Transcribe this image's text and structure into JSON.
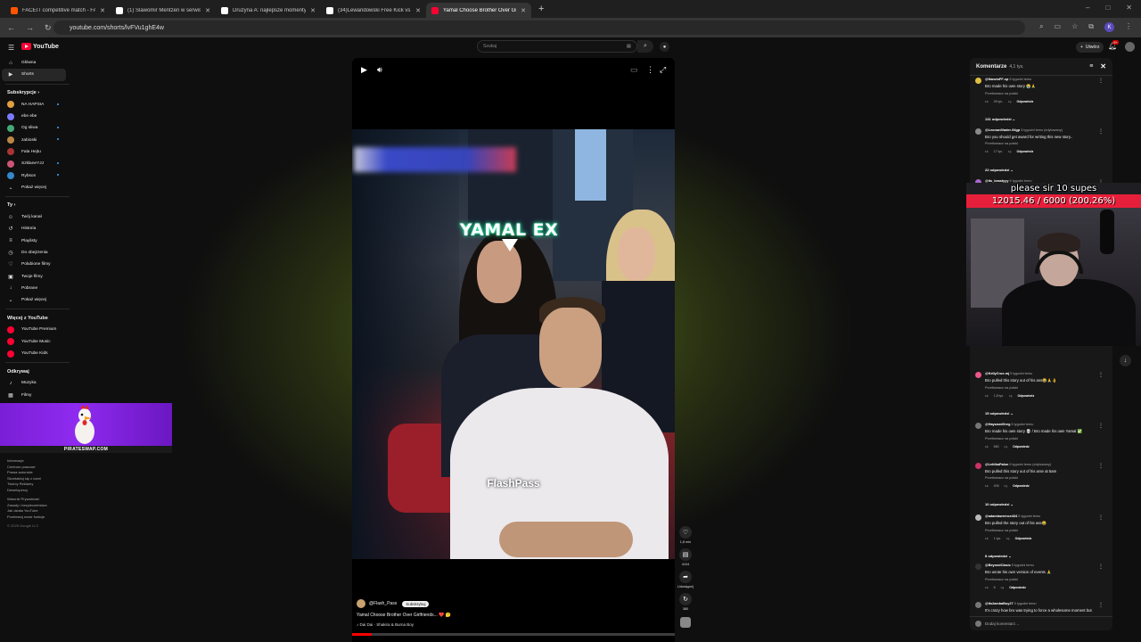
{
  "browser": {
    "tabs": [
      {
        "title": "FACEIT competitive match - FA",
        "color": "#ff5500",
        "active": false
      },
      {
        "title": "(1) Slawomir Mentzen w serwis",
        "color": "#ffffff",
        "active": false
      },
      {
        "title": "Drużyna A: najlepsze momenty",
        "color": "#ffffff",
        "active": false
      },
      {
        "title": "(34)Lewandowski Free Kick vs B",
        "color": "#ffffff",
        "active": false
      },
      {
        "title": "Yamal Choose Brother Over Gir",
        "color": "#ff0033",
        "active": true
      }
    ],
    "url": "youtube.com/shorts/lvFVu1ghE4w",
    "profile_initial": "K"
  },
  "header": {
    "logo": "YouTube",
    "search_placeholder": "Szukaj",
    "create_label": "Utwórz",
    "notif_count": "9+"
  },
  "sidebar": {
    "main": [
      {
        "label": "Główna",
        "icon": "⌂"
      },
      {
        "label": "Shorts",
        "icon": "▶"
      }
    ],
    "subs_title": "Subskrypcje",
    "subs": [
      {
        "label": "NA HAPSIA",
        "color": "#e0a040",
        "dot": true
      },
      {
        "label": "ebe ebe",
        "color": "#7a7aff",
        "dot": false
      },
      {
        "label": "Og sliwa",
        "color": "#44aa77",
        "dot": true
      },
      {
        "label": "zabioski",
        "color": "#bb8844",
        "dot": true
      },
      {
        "label": "Fala Hejtu",
        "color": "#aa3333",
        "dot": false
      },
      {
        "label": "SzklaneYJJ",
        "color": "#cc5577",
        "dot": true
      },
      {
        "label": "Rybson",
        "color": "#3388cc",
        "dot": true
      },
      {
        "label": "Pokaż więcej",
        "color": "",
        "dot": false
      }
    ],
    "you_title": "Ty",
    "you": [
      {
        "label": "Twój kanał",
        "icon": "☺"
      },
      {
        "label": "Historia",
        "icon": "↺"
      },
      {
        "label": "Playlisty",
        "icon": "≡"
      },
      {
        "label": "Do obejrzenia",
        "icon": "◷"
      },
      {
        "label": "Polubione filmy",
        "icon": "♡"
      },
      {
        "label": "Twoje filmy",
        "icon": "▣"
      },
      {
        "label": "Pobrane",
        "icon": "↓"
      },
      {
        "label": "Pokaż więcej",
        "icon": "⌄"
      }
    ],
    "more_title": "Więcej z YouTube",
    "more": [
      {
        "label": "YouTube Premium",
        "color": "#ff0033"
      },
      {
        "label": "YouTube Music",
        "color": "#ff0033"
      },
      {
        "label": "YouTube Kids",
        "color": "#ff0033"
      }
    ],
    "explore_title": "Odkrywaj",
    "explore": [
      {
        "label": "Muzyka",
        "icon": "♪"
      },
      {
        "label": "Filmy",
        "icon": "▦"
      }
    ]
  },
  "ad": {
    "text": "PIRATESWAP.COM"
  },
  "footer": {
    "lines1": [
      "Informacje",
      "Centrum prasowe",
      "Prawa autorskie",
      "Skontaktuj się z nami",
      "Twórcy   Reklamy",
      "Deweloperzy"
    ],
    "lines2": [
      "Warunki   Prywatność",
      "Zasady i bezpieczeństwo",
      "Jak działa YouTube",
      "Przetestuj nowe funkcje"
    ],
    "copyright": "© 2025 Google LLC"
  },
  "short": {
    "overlay_title": "YAMAL EX",
    "overlay_brand": "FlashPass",
    "channel": "@Flash_Pass",
    "subscribe_label": "Subskrybuj",
    "title": "Yamal Choose Brother Over Girlfriends... ❤️ 🤔",
    "song": "♪ Dai Dai · Shakira & Burna Boy",
    "progress": 0.06
  },
  "actions": {
    "like_count": "1,8 mln",
    "comment_count": "4104",
    "share_label": "Udostępnij",
    "remix_count": "380"
  },
  "comments_panel": {
    "title": "Komentarze",
    "count": "4,1 tys.",
    "add_placeholder": "Dodaj komentarz…",
    "translate_label": "Przetłumacz na polski",
    "reply_label": "Odpowiedz",
    "items": [
      {
        "user": "@NarutoFF-xp",
        "when": "5 tygodni temu",
        "text": "Bro made his own story 😭🙏",
        "likes": "26 tys.",
        "replies": "131 odpowiedzi",
        "color": "#e0c040"
      },
      {
        "user": "@LeonardVader-94gp",
        "when": "5 tygodni temu (edytowany)",
        "text": "Bro you should get award for writing this new story..",
        "likes": "17 tys.",
        "replies": "22 odpowiedzi",
        "color": "#8a8a8a"
      },
      {
        "user": "@its_beastyyy",
        "when": "5 tygodni temu",
        "text": "Bro whipped this story up out of thin air",
        "likes": "1,7 tys.",
        "replies": "4 odpowiedzi",
        "color": "#aa66cc"
      },
      {
        "user": "@KellyCrue-mj",
        "when": "5 tygodni temu",
        "text": "Bro pulled this story out of his ass😂🙏👌",
        "likes": "1,8 tys.",
        "replies": "15 odpowiedzi",
        "color": "#ee5588"
      },
      {
        "user": "@HaywardGreg",
        "when": "5 tygodni temu",
        "text": "Bro made his own story 💀 / Bro made his own Yamal ✅",
        "likes": "580",
        "replies": "",
        "color": "#777777"
      },
      {
        "user": "@LettikaPalon",
        "when": "5 tygodni temu (edytowany)",
        "text": "Bro pulled this story out of his arse at 5am",
        "likes": "405",
        "replies": "10 odpowiedzi",
        "color": "#cc3366"
      },
      {
        "user": "@adamlawrence434",
        "when": "5 tygodni temu",
        "text": "Bro pulled the story out of his ass😂",
        "likes": "1 tys.",
        "replies": "8 odpowiedzi",
        "color": "#bbbbbb"
      },
      {
        "user": "@BeyondClasic",
        "when": "5 tygodni temu",
        "text": "Bro wrote his own version of events 🙏",
        "likes": "8",
        "replies": "",
        "color": "#333333"
      },
      {
        "user": "@its2ambaBoy27",
        "when": "5 tygodni temu",
        "text": "It's crazy how bro was trying to force a wholesome moment but",
        "likes": "",
        "replies": "",
        "color": "#777777"
      }
    ]
  },
  "overlay": {
    "subgoal_label": "please sir 10 supes",
    "subgoal_value": "12015.46 / 6000 (200.26%)"
  }
}
